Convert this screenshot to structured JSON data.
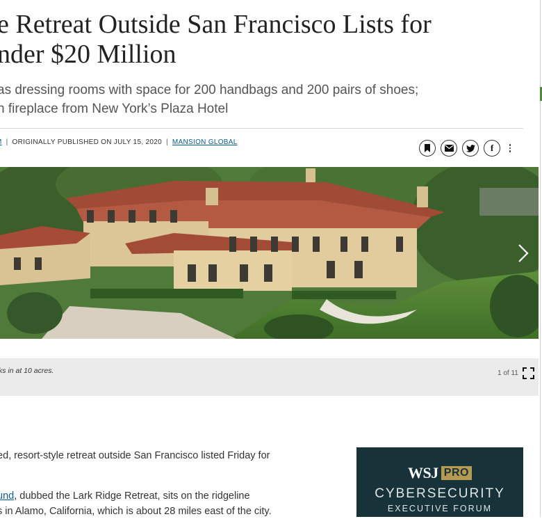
{
  "article": {
    "headline_line1": "e Retreat Outside San Francisco Lists for",
    "headline_line2": "nder $20 Million",
    "dek_line1": "as dressing rooms with space for 200 handbags and 200 pairs of shoes;",
    "dek_line2": "n fireplace from New York’s Plaza Hotel",
    "byline": {
      "author_fragment": "M",
      "published": "ORIGINALLY PUBLISHED ON JULY 15, 2020",
      "source": "MANSION GLOBAL"
    }
  },
  "share": {
    "icons": [
      "bookmark-icon",
      "email-icon",
      "twitter-icon",
      "facebook-icon",
      "more-icon"
    ],
    "facebook_glyph": "f"
  },
  "slideshow": {
    "caption": "ks in at 10 acres.",
    "counter": "1 of 11"
  },
  "body": {
    "para1": "ed, resort-style retreat outside San Francisco listed Friday for",
    "para2_link": "und",
    "para2_rest": ", dubbed the Lark Ridge Retreat, sits on the ridgeline",
    "para3": "s in Alamo, California, which is about 28 miles east of the city."
  },
  "ad": {
    "brand": "WSJ",
    "badge": "PRO",
    "title": "CYBERSECURITY",
    "subtitle": "EXECUTIVE FORUM"
  },
  "colors": {
    "link": "#0b5a8a",
    "ad_bg": "#173238",
    "ad_badge": "#b79a52",
    "caption_bg": "#ebebeb"
  }
}
